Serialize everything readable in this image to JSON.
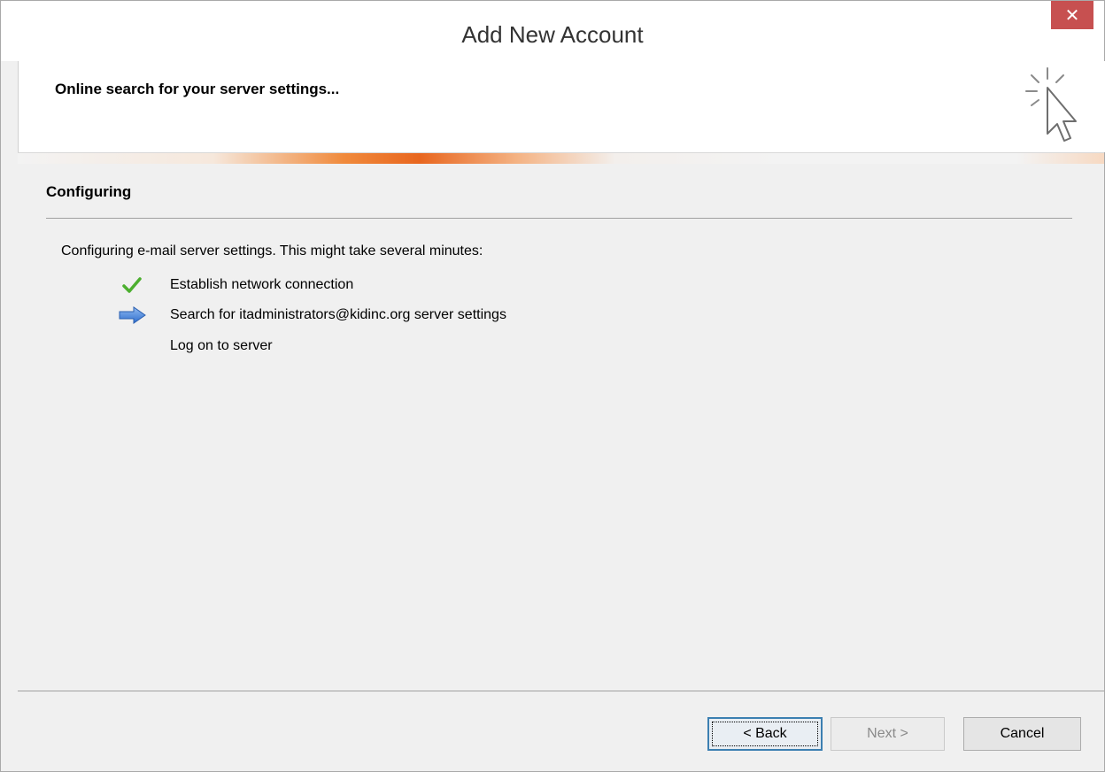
{
  "window": {
    "title": "Add New Account",
    "close_label": "✕"
  },
  "header": {
    "title": "Online search for your server settings...",
    "icon": "cursor-click-icon"
  },
  "section": {
    "title": "Configuring",
    "intro": "Configuring e-mail server settings. This might take several minutes:"
  },
  "steps": [
    {
      "label": "Establish network connection",
      "status": "done",
      "icon": "checkmark-icon"
    },
    {
      "label": "Search for itadministrators@kidinc.org server settings",
      "status": "in-progress",
      "icon": "arrow-right-icon"
    },
    {
      "label": "Log on to server",
      "status": "pending",
      "icon": ""
    }
  ],
  "buttons": {
    "back": "< Back",
    "next": "Next >",
    "cancel": "Cancel"
  },
  "colors": {
    "close": "#c75050",
    "progress_accent": "#e8661f",
    "check": "#4caf2f",
    "arrow": "#3a7bd5"
  }
}
